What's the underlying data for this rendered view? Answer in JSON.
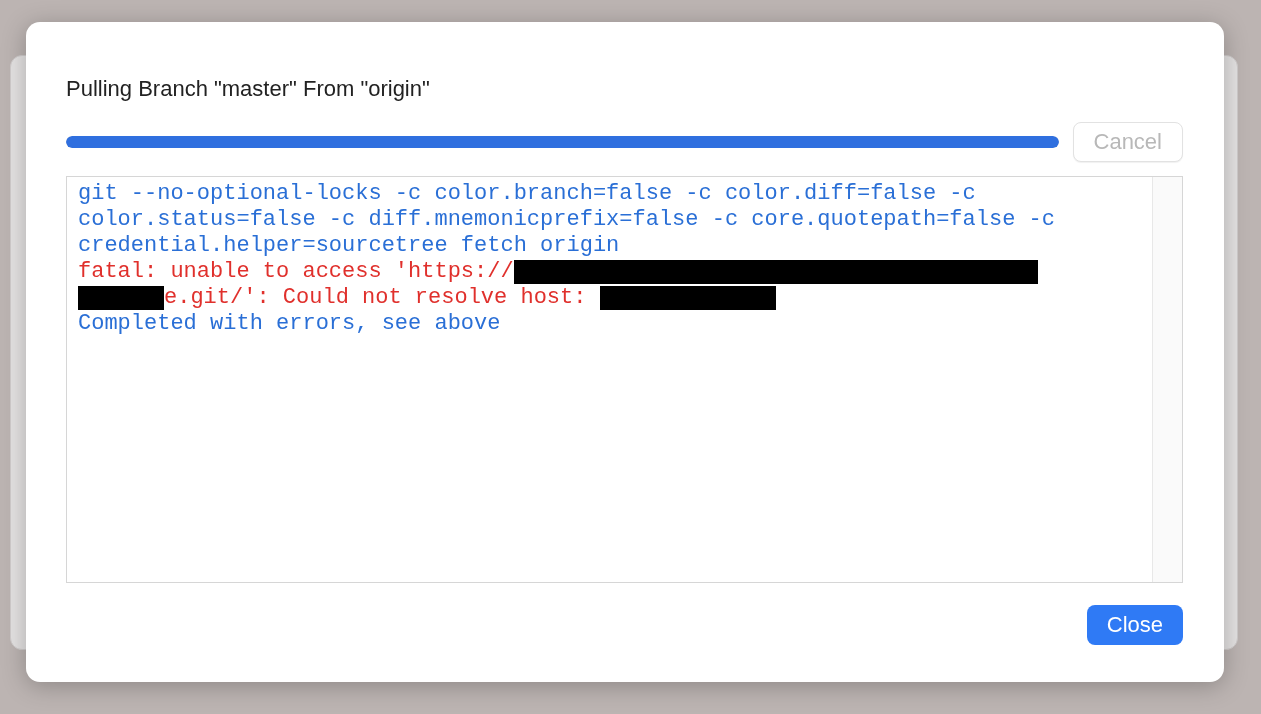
{
  "dialog": {
    "title": "Pulling Branch \"master\" From \"origin\"",
    "progress": {
      "level": 1
    },
    "cancel_button": {
      "label": "Cancel",
      "disabled": true
    },
    "log": [
      {
        "kind": "command",
        "segments": [
          {
            "kind": "text",
            "text": "git --no-optional-locks -c color.branch=false -c color.diff=false -c"
          }
        ]
      },
      {
        "kind": "command",
        "segments": [
          {
            "kind": "text",
            "text": "color.status=false -c diff.mnemonicprefix=false -c core.quotepath=false -c"
          }
        ]
      },
      {
        "kind": "command",
        "segments": [
          {
            "kind": "text",
            "text": "credential.helper=sourcetree fetch origin"
          }
        ]
      },
      {
        "kind": "error",
        "segments": [
          {
            "kind": "text",
            "text": "fatal: unable to access 'https://"
          },
          {
            "kind": "redacted"
          }
        ]
      },
      {
        "kind": "error",
        "segments": [
          {
            "kind": "redacted"
          },
          {
            "kind": "text",
            "text": "e.git/': Could not resolve host: "
          },
          {
            "kind": "redacted"
          }
        ]
      },
      {
        "kind": "status",
        "segments": [
          {
            "kind": "text",
            "text": "Completed with errors, see above"
          }
        ]
      }
    ],
    "close_button": {
      "label": "Close",
      "disabled": false
    }
  }
}
